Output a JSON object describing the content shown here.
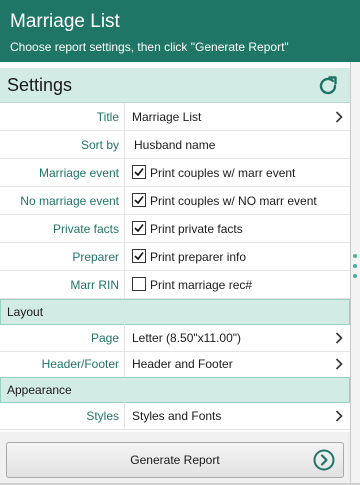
{
  "header": {
    "title": "Marriage List",
    "subtitle": "Choose report settings, then click \"Generate Report\""
  },
  "settings": {
    "heading": "Settings",
    "rows": [
      {
        "label": "Title",
        "value": "Marriage List"
      },
      {
        "label": "Sort by",
        "value": "Husband name"
      },
      {
        "label": "Marriage event",
        "value": "Print couples w/ marr event",
        "checked": true
      },
      {
        "label": "No marriage event",
        "value": "Print couples w/ NO marr event",
        "checked": true
      },
      {
        "label": "Private facts",
        "value": "Print private facts",
        "checked": true
      },
      {
        "label": "Preparer",
        "value": "Print preparer info",
        "checked": true
      },
      {
        "label": "Marr RIN",
        "value": "Print marriage rec#",
        "checked": false
      }
    ]
  },
  "layout": {
    "heading": "Layout",
    "rows": [
      {
        "label": "Page",
        "value": "Letter (8.50\"x11.00\")"
      },
      {
        "label": "Header/Footer",
        "value": "Header and Footer"
      }
    ]
  },
  "appearance": {
    "heading": "Appearance",
    "rows": [
      {
        "label": "Styles",
        "value": "Styles and Fonts"
      }
    ]
  },
  "footer": {
    "generate_label": "Generate Report"
  },
  "colors": {
    "accent": "#1f7566",
    "section_bg": "#d3ebe5"
  },
  "icons": {
    "refresh": "refresh-icon",
    "chevron": "chevron-right-icon",
    "generate": "arrow-circle-right-icon"
  }
}
